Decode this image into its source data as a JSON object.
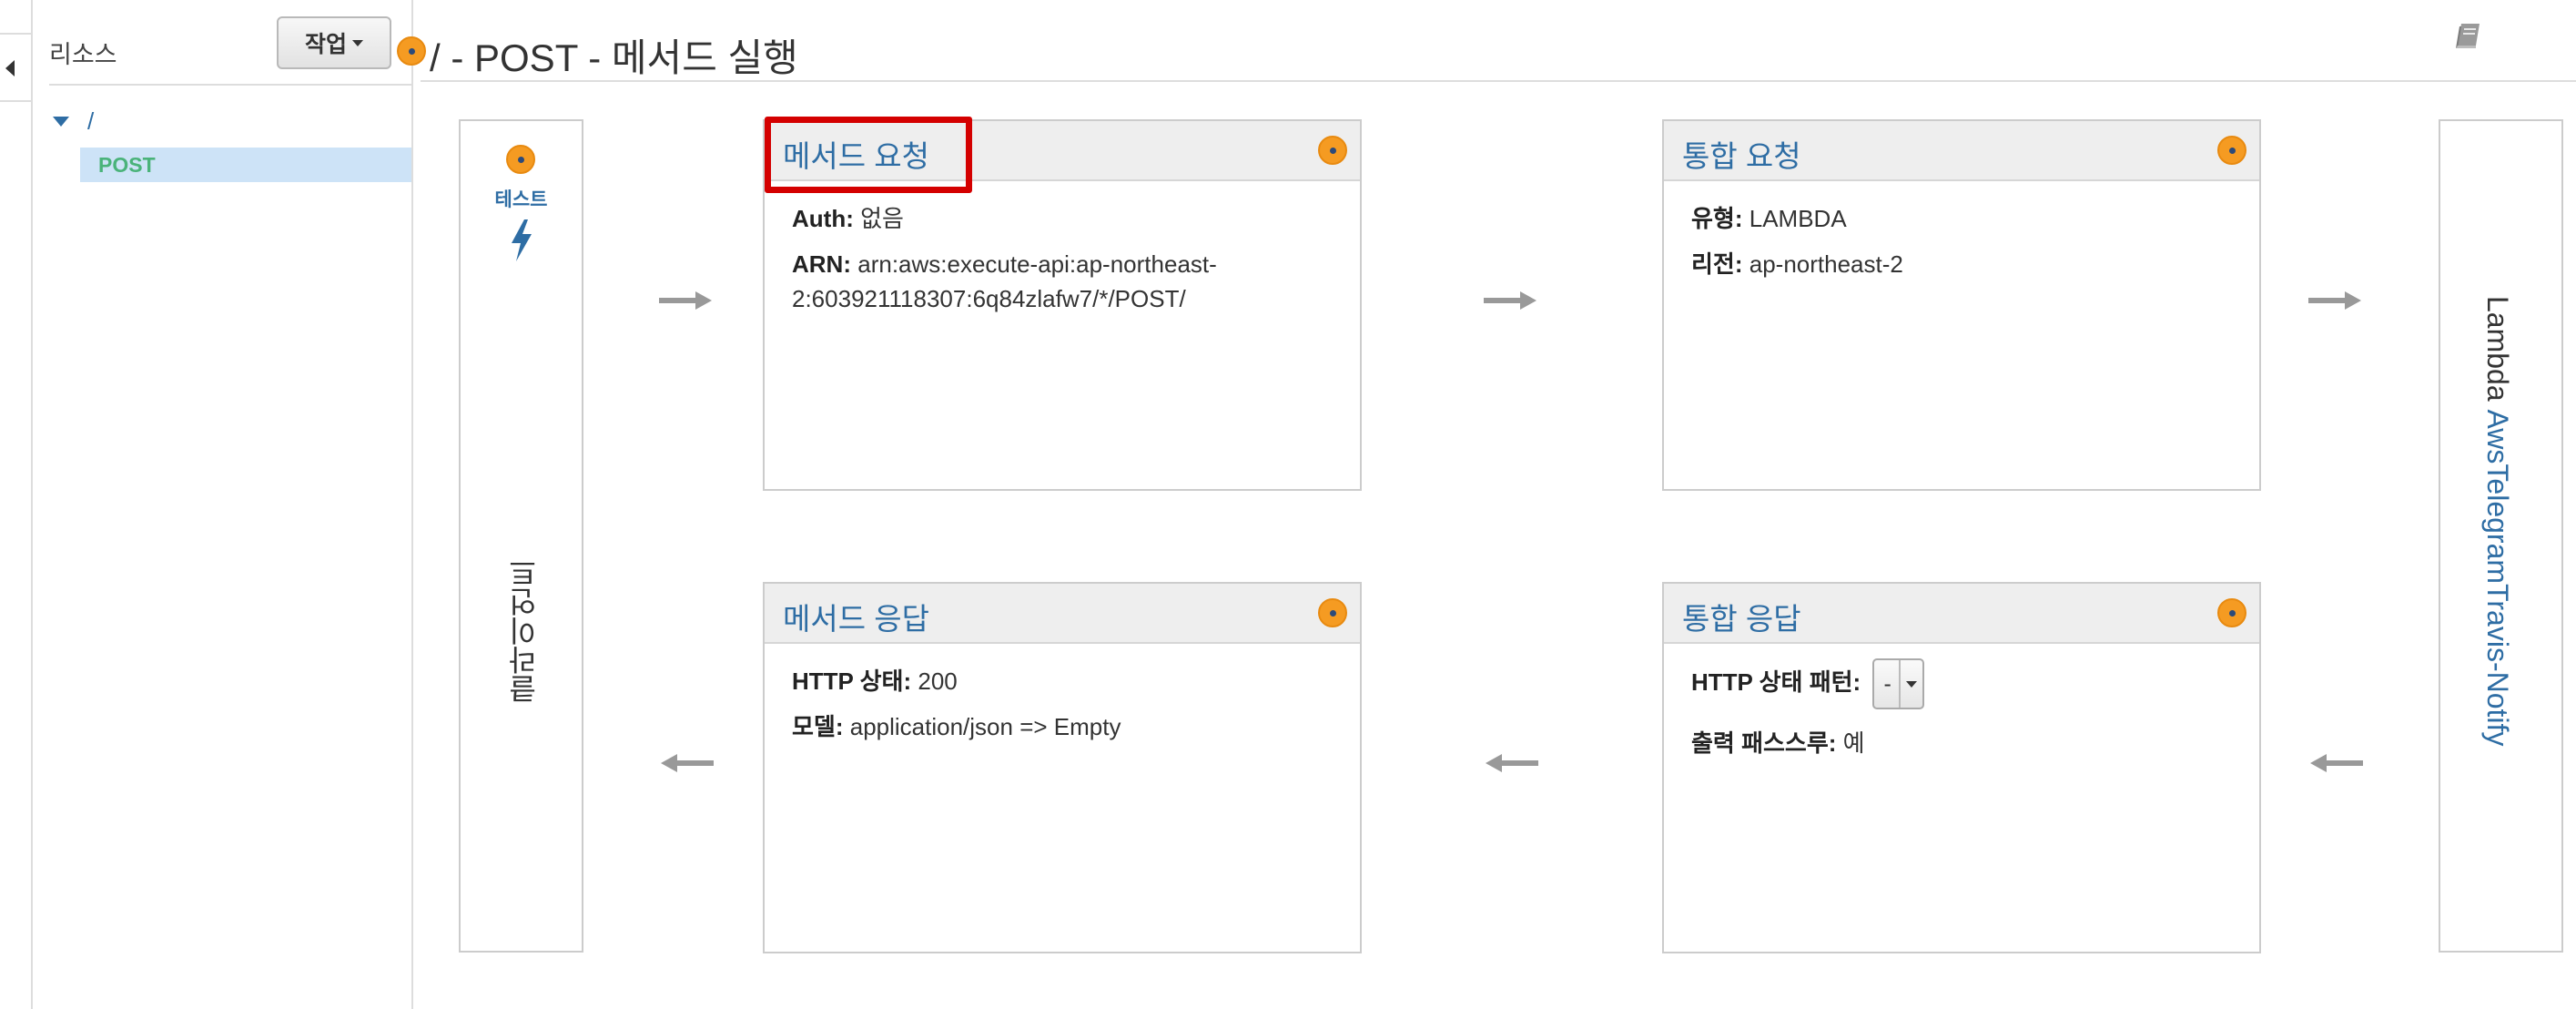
{
  "sidebar": {
    "title": "리소스",
    "action_button": "작업",
    "tree": {
      "root": "/",
      "method": "POST"
    }
  },
  "page": {
    "title": "/ - POST - 메서드 실행"
  },
  "client": {
    "test_label": "테스트",
    "label": "클라이언트"
  },
  "method_request": {
    "title": "메서드 요청",
    "auth_label": "Auth:",
    "auth_value": "없음",
    "arn_label": "ARN:",
    "arn_value_line1": "arn:aws:execute-api:ap-northeast-",
    "arn_value_line2": "2:603921118307:6q84zlafw7/*/POST/"
  },
  "integration_request": {
    "title": "통합 요청",
    "type_label": "유형:",
    "type_value": "LAMBDA",
    "region_label": "리전:",
    "region_value": "ap-northeast-2"
  },
  "method_response": {
    "title": "메서드 응답",
    "status_label": "HTTP 상태:",
    "status_value": "200",
    "model_label": "모델:",
    "model_value": "application/json => Empty"
  },
  "integration_response": {
    "title": "통합 응답",
    "pattern_label": "HTTP 상태 패턴:",
    "pattern_value": "-",
    "passthrough_label": "출력 패스스루:",
    "passthrough_value": "예"
  },
  "lambda": {
    "label": "Lambda",
    "function_name": "AwsTelegramTravis-Notify"
  },
  "icons": {
    "collapse": "chevron-left-icon",
    "book": "book-icon",
    "bolt": "lightning-bolt-icon",
    "marker": "orange-dot-icon",
    "arrow_right": "arrow-right-icon",
    "arrow_left": "arrow-left-icon"
  },
  "colors": {
    "link": "#2e6da4",
    "post": "#4ab37a",
    "marker": "#f59b22",
    "highlight": "#d40000",
    "selected_row": "#cde3f7"
  }
}
